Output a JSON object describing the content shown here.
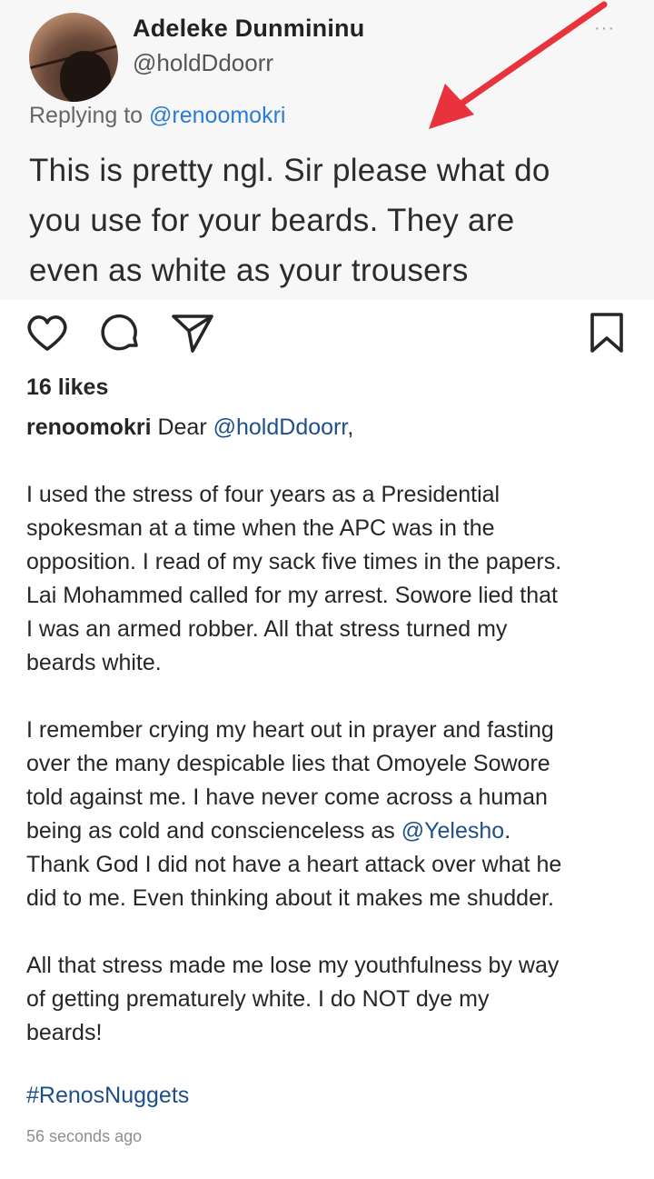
{
  "tweet": {
    "display_name": "Adeleke Dunmininu",
    "handle": "@holdDdoorr",
    "more_glyph": "···",
    "replying_prefix": "Replying to ",
    "replying_to": "@renoomokri",
    "text_lines": [
      "This is pretty ngl. Sir please what do",
      "you use for your beards. They are",
      "even as white as your trousers"
    ],
    "arrow_color": "#e8323c"
  },
  "actions": {
    "like_icon": "heart-icon",
    "comment_icon": "comment-bubble-icon",
    "share_icon": "paper-plane-icon",
    "save_icon": "bookmark-icon"
  },
  "post": {
    "likes": "16 likes",
    "username": "renoomokri",
    "greeting_prefix": " Dear ",
    "greeting_mention": "@holdDdoorr",
    "greeting_suffix": ",",
    "para1_lines": [
      "I used the stress of four years as a Presidential",
      "spokesman at a time when the APC was in the",
      "opposition. I read of my sack five times in the papers.",
      "Lai Mohammed called for my arrest. Sowore lied that",
      "I was an armed robber. All that stress turned my",
      "beards white."
    ],
    "para2_lines": [
      "I remember crying my heart out in prayer and fasting",
      "over the many despicable lies that Omoyele Sowore",
      "told against me. I have never come across a human"
    ],
    "para2_line4_prefix": "being as cold and conscienceless as ",
    "para2_line4_mention": "@Yelesho",
    "para2_line4_suffix": ".",
    "para2_lines_end": [
      "Thank God I did not have a heart attack over what he",
      "did to me. Even thinking about it makes me shudder."
    ],
    "para3_lines": [
      "All that stress made me lose my youthfulness by way",
      "of getting prematurely white. I do NOT dye my",
      "beards!"
    ],
    "hashtag": "#RenosNuggets",
    "timestamp": "56 seconds ago"
  },
  "colors": {
    "link_blue": "#1f4f8a",
    "tweet_link_blue": "#2a7bd6",
    "text": "#262626",
    "muted": "#8e8e8e"
  }
}
